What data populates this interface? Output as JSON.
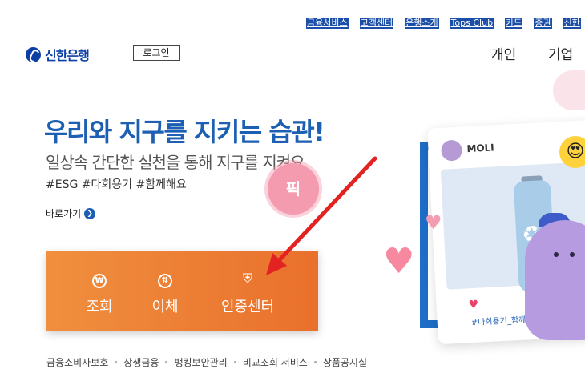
{
  "top_links": [
    "금융서비스",
    "고객센터",
    "은행소개",
    "Tops Club",
    "카드",
    "증권",
    "신한"
  ],
  "header": {
    "logo_text": "신한은행",
    "login_label": "로그인",
    "nav": [
      "개인",
      "기업"
    ]
  },
  "hero": {
    "title": "우리와 지구를 지키는 습관!",
    "subtitle": "일상속 간단한 실천을 통해 지구를 지켜요",
    "tags": "#ESG #다회용기 #함께해요",
    "more_label": "바로가기",
    "badge": "픽"
  },
  "card": {
    "user": "MOLI",
    "hashtag": "#다회용기_함께"
  },
  "quick_menu": [
    {
      "icon": "won-search-icon",
      "label": "조회"
    },
    {
      "icon": "transfer-icon",
      "label": "이체"
    },
    {
      "icon": "shield-icon",
      "label": "인증센터"
    }
  ],
  "footer_links": [
    "금융소비자보호",
    "상생금융",
    "뱅킹보안관리",
    "비교조회 서비스",
    "상품공시실"
  ],
  "colors": {
    "brand_blue": "#0b3fa6",
    "title_blue": "#1d5fb3",
    "quick_orange": "#ec7a33",
    "annotation_red": "#e32222"
  }
}
